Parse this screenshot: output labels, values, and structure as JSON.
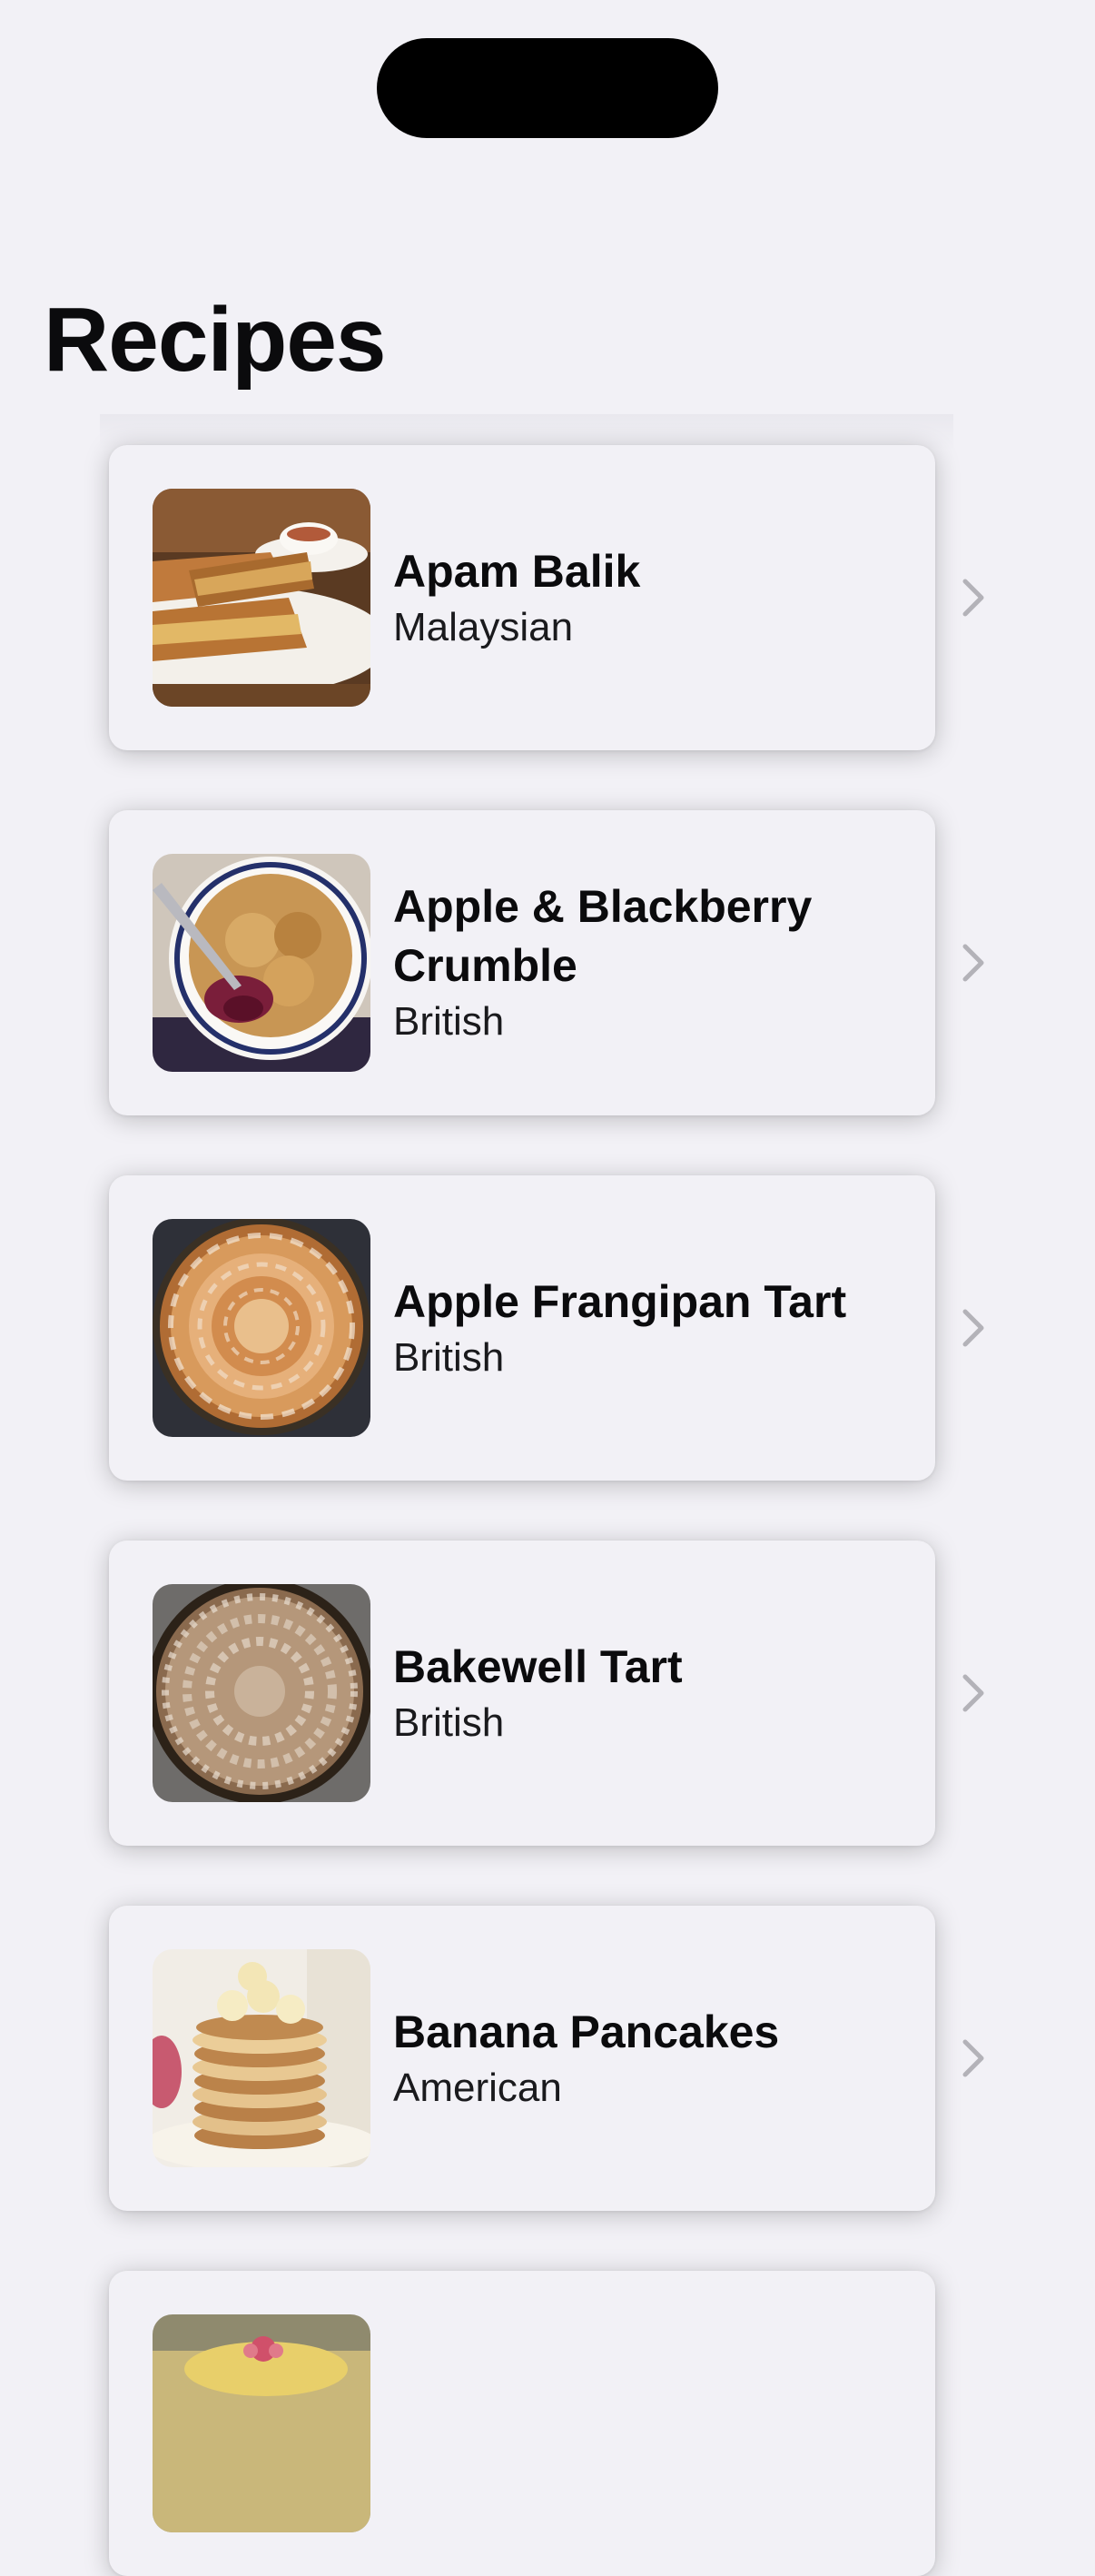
{
  "header": {
    "title": "Recipes"
  },
  "recipes": [
    {
      "name": "Apam Balik",
      "cuisine": "Malaysian",
      "image": "apam-balik-photo"
    },
    {
      "name": "Apple & Blackberry Crumble",
      "cuisine": "British",
      "image": "apple-blackberry-crumble-photo"
    },
    {
      "name": "Apple Frangipan Tart",
      "cuisine": "British",
      "image": "apple-frangipan-tart-photo"
    },
    {
      "name": "Bakewell Tart",
      "cuisine": "British",
      "image": "bakewell-tart-photo"
    },
    {
      "name": "Banana Pancakes",
      "cuisine": "American",
      "image": "banana-pancakes-photo"
    },
    {
      "name": "",
      "cuisine": "",
      "image": "partially-visible-cake-photo"
    }
  ],
  "icons": {
    "row_disclosure": "chevron-right-icon"
  },
  "colors": {
    "background": "#f2f1f6",
    "text_primary": "#0b0b0d",
    "chevron": "#b3b2b8"
  }
}
